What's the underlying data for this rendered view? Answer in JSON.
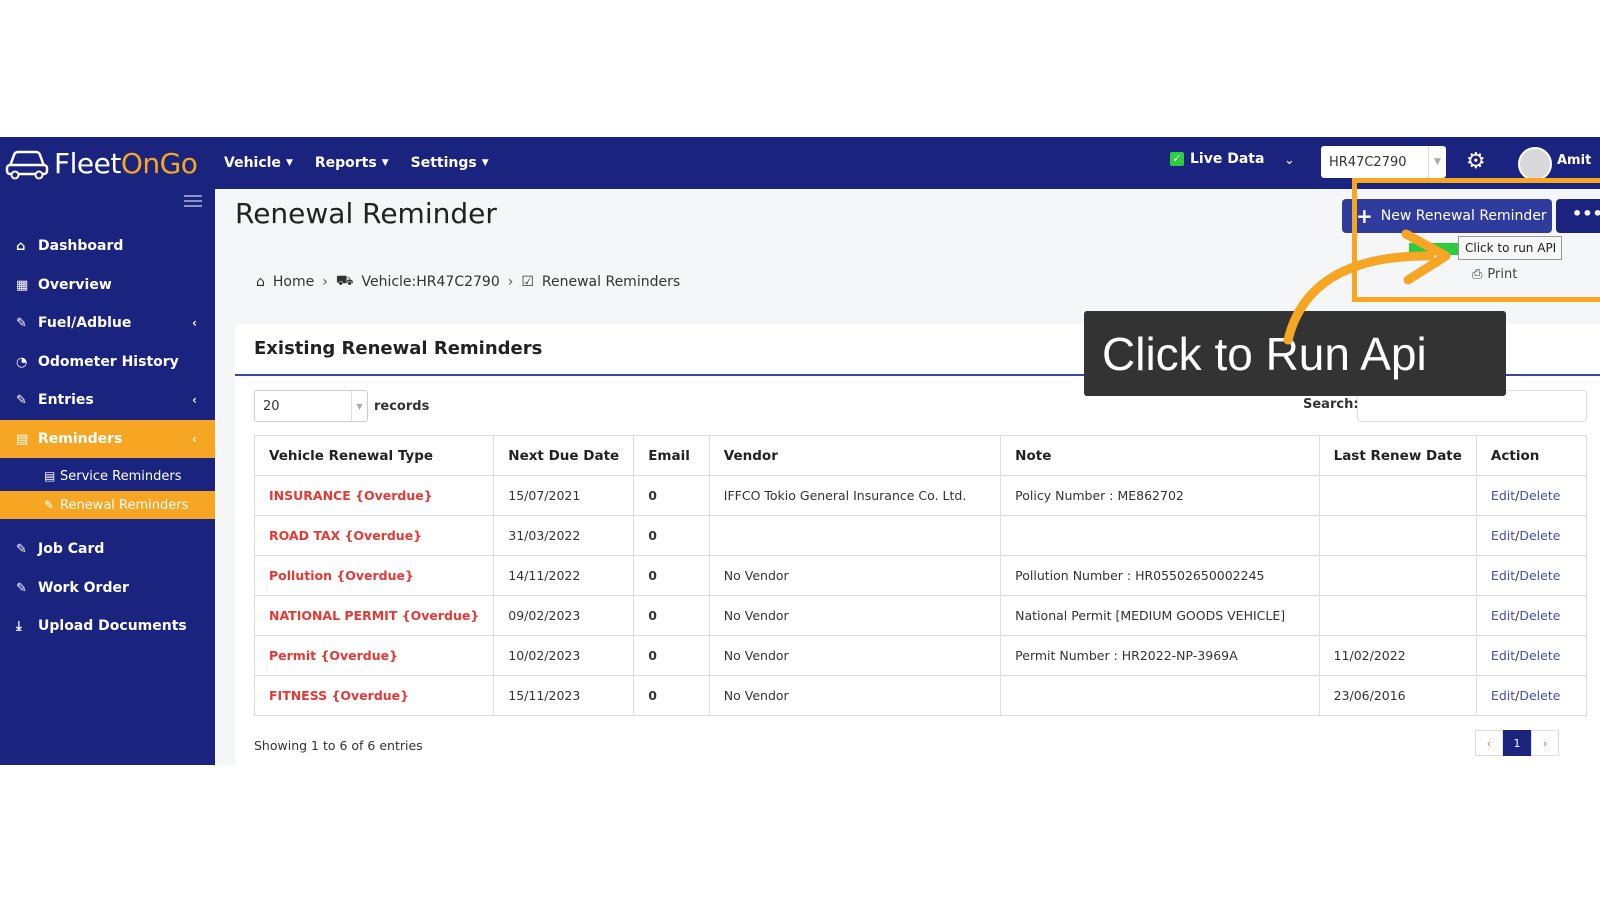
{
  "app": {
    "logo_word": "Fleet",
    "logo_accent": "OnGo"
  },
  "topnav": {
    "vehicle": "Vehicle",
    "reports": "Reports",
    "settings": "Settings"
  },
  "topbar": {
    "live_data": "Live Data",
    "vehicle_select": "HR47C2790",
    "user": "Amit"
  },
  "sidebar": {
    "items": [
      {
        "label": "Dashboard",
        "icon": "home-icon"
      },
      {
        "label": "Overview",
        "icon": "grid-icon"
      },
      {
        "label": "Fuel/Adblue",
        "icon": "edit-icon"
      },
      {
        "label": "Odometer History",
        "icon": "gauge-icon"
      },
      {
        "label": "Entries",
        "icon": "edit-icon"
      },
      {
        "label": "Reminders",
        "icon": "calendar-icon"
      },
      {
        "label": "Service Reminders",
        "icon": "calendar-icon"
      },
      {
        "label": "Renewal Reminders",
        "icon": "edit-icon"
      },
      {
        "label": "Job Card",
        "icon": "edit-icon"
      },
      {
        "label": "Work Order",
        "icon": "edit-icon"
      },
      {
        "label": "Upload Documents",
        "icon": "download-icon"
      }
    ]
  },
  "page": {
    "title": "Renewal Reminder",
    "new_button": "New Renewal Reminder",
    "more_button": "•••",
    "tooltip": "Click to run API",
    "print": "Print"
  },
  "breadcrumb": {
    "home": "Home",
    "vehicle": "Vehicle:HR47C2790",
    "current": "Renewal Reminders"
  },
  "card": {
    "title": "Existing Renewal Reminders",
    "records_value": "20",
    "records_label": "records",
    "search_label": "Search:",
    "showing": "Showing 1 to 6 of 6 entries",
    "page_current": "1"
  },
  "table": {
    "headers": [
      "Vehicle Renewal Type",
      "Next Due Date",
      "Email",
      "Vendor",
      "Note",
      "Last Renew Date",
      "Action"
    ],
    "rows": [
      [
        "INSURANCE {Overdue}",
        "15/07/2021",
        "0",
        "IFFCO Tokio General Insurance Co. Ltd.",
        "Policy Number : ME862702",
        "",
        "Edit",
        "Delete"
      ],
      [
        "ROAD TAX {Overdue}",
        "31/03/2022",
        "0",
        "",
        "",
        "",
        "Edit",
        "Delete"
      ],
      [
        "Pollution {Overdue}",
        "14/11/2022",
        "0",
        "No Vendor",
        "Pollution Number : HR05502650002245",
        "",
        "Edit",
        "Delete"
      ],
      [
        "NATIONAL PERMIT {Overdue}",
        "09/02/2023",
        "0",
        "No Vendor",
        "National Permit [MEDIUM GOODS VEHICLE]",
        "",
        "Edit",
        "Delete"
      ],
      [
        "Permit {Overdue}",
        "10/02/2023",
        "0",
        "No Vendor",
        "Permit Number : HR2022-NP-3969A",
        "11/02/2022",
        "Edit",
        "Delete"
      ],
      [
        "FITNESS {Overdue}",
        "15/11/2023",
        "0",
        "No Vendor",
        "",
        "23/06/2016",
        "Edit",
        "Delete"
      ]
    ]
  },
  "overlay": {
    "callout": "Click to Run Api"
  },
  "colors": {
    "navy": "#1a237e",
    "accent": "#f6a623",
    "overdue": "#e53935",
    "link": "#3f51b5"
  }
}
